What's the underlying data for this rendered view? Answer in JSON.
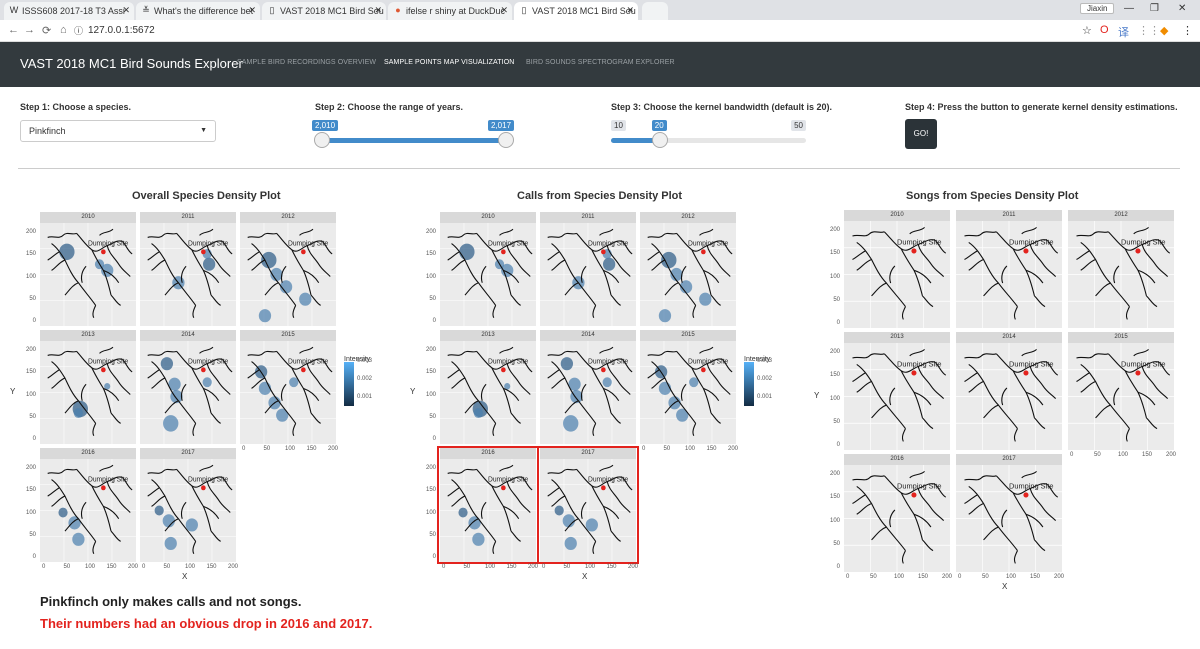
{
  "browser": {
    "tabs": [
      {
        "title": "ISSS608 2017-18 T3 Assi",
        "icon": "W"
      },
      {
        "title": "What's the difference bet",
        "icon": "≚"
      },
      {
        "title": "VAST 2018 MC1 Bird Sou",
        "icon": "▯"
      },
      {
        "title": "ifelse r shiny at DuckDuc",
        "icon": "●"
      },
      {
        "title": "VAST 2018 MC1 Bird Sou",
        "icon": "▯"
      }
    ],
    "url": "127.0.0.1:5672",
    "profile_label": "Jiaxin"
  },
  "app": {
    "title": "VAST 2018 MC1 Bird Sounds Explorer",
    "nav": [
      "SAMPLE BIRD RECORDINGS OVERVIEW",
      "SAMPLE POINTS MAP VISUALIZATION",
      "BIRD SOUNDS SPECTROGRAM EXPLORER"
    ],
    "active_nav": 1
  },
  "controls": {
    "step1_label": "Step 1: Choose a species.",
    "species_value": "Pinkfinch",
    "step2_label": "Step 2: Choose the range of years.",
    "year_min": "2,010",
    "year_max": "2,017",
    "year_fill": [
      0.0,
      1.0
    ],
    "step3_label": "Step 3: Choose the kernel bandwidth (default is 20).",
    "bw_min_label": "10",
    "bw_value": "20",
    "bw_max_label": "50",
    "bw_fraction": 0.25,
    "step4_label": "Step 4: Press the button to generate kernel density estimations.",
    "go_label": "GO!"
  },
  "plots": {
    "overall_title": "Overall Species Density Plot",
    "calls_title": "Calls from Species Density Plot",
    "songs_title": "Songs from Species Density Plot",
    "years": [
      "2010",
      "2011",
      "2012",
      "2013",
      "2014",
      "2015",
      "2016",
      "2017"
    ],
    "site_label": "Dumping Site",
    "y_axis_letter": "Y",
    "x_axis_letter": "X",
    "y_ticks": [
      "200",
      "150",
      "100",
      "50",
      "0"
    ],
    "x_ticks": [
      "0",
      "50",
      "100",
      "150",
      "200"
    ],
    "legend_title": "Intensity",
    "legend_ticks": [
      "0.003",
      "0.002",
      "0.001"
    ],
    "highlighted_facets": [
      "2016",
      "2017"
    ]
  },
  "notes": {
    "line1": "Pinkfinch only makes calls and not songs.",
    "line2": "Their numbers had an obvious drop in 2016 and 2017."
  }
}
